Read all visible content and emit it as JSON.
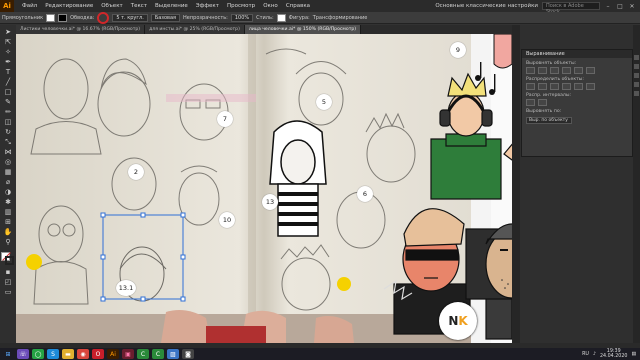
{
  "app": {
    "logo": "Ai"
  },
  "menu": {
    "items": [
      "Файл",
      "Редактирование",
      "Объект",
      "Текст",
      "Выделение",
      "Эффект",
      "Просмотр",
      "Окно",
      "Справка"
    ],
    "workspace": "Основные классические настройки",
    "search_placeholder": "Поиск в Adobe Stock"
  },
  "control_bar": {
    "selection": "Прямоугольник",
    "stroke_label": "Обводка:",
    "stroke_style": "5 т. кругл.",
    "brush": "Базовая",
    "opacity_label": "Непрозрачность:",
    "opacity_value": "100%",
    "style_label": "Стиль:",
    "shape_label": "Фигура:",
    "transform_label": "Трансформирование"
  },
  "tabs": [
    {
      "label": "Листики человечки.ai* @ 16.67% (RGB/Просмотр)",
      "active": false
    },
    {
      "label": "для инсты.ai* @ 25% (RGB/Просмотр)",
      "active": false
    },
    {
      "label": "лица человечки.ai* @ 150% (RGB/Просмотр)",
      "active": true
    }
  ],
  "canvas": {
    "labels": [
      "9",
      "7",
      "5",
      "2",
      "13",
      "6",
      "10",
      "13.1"
    ],
    "badge_text": "N",
    "badge_accent": "K"
  },
  "panel": {
    "title": "Выравнивание",
    "align_objects": "Выровнять объекты:",
    "distribute_objects": "Распределить объекты:",
    "distribute_spacing": "Распр. интервалы:",
    "align_to": "Выровнять по:",
    "align_to_value": "Выр. по объекту"
  },
  "taskbar": {
    "lang": "RU",
    "time": "19:39",
    "date": "24.04.2020"
  },
  "colors": {
    "accent_red": "#d0272a",
    "illustrator_orange": "#ff9a00",
    "green_sweater": "#2e7d3a",
    "marker_yellow": "#f5d100"
  }
}
